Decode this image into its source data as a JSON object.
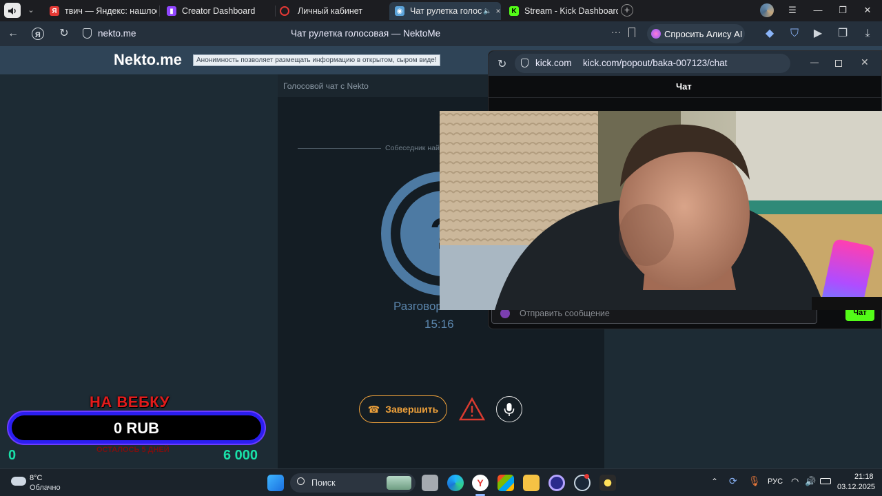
{
  "browser": {
    "tabs": [
      {
        "label": "твич — Яндекс: нашлось",
        "favicon": "yandex-icon",
        "color": "#e53935"
      },
      {
        "label": "Creator Dashboard",
        "favicon": "twitch-icon",
        "color": "#9146ff"
      },
      {
        "label": "Личный кабинет",
        "favicon": "opera-icon",
        "color": "#e53935"
      },
      {
        "label": "Чат рулетка голосо",
        "favicon": "nekto-icon",
        "color": "#5ba3d9",
        "active": true
      },
      {
        "label": "Stream - Kick Dashboard",
        "favicon": "kick-icon",
        "color": "#53fc18"
      }
    ],
    "address": "nekto.me",
    "page_title": "Чат рулетка голосовая — NektoMe",
    "alice_button": "Спросить Алису AI"
  },
  "nekto": {
    "logo": "Nekto.me",
    "tagline": "Анонимность позволяет размещать информацию в открытом, сыром виде!",
    "panel_title": "Голосовой чат с Nekto",
    "divider_text": "Собеседник най",
    "status_text": "Разговор",
    "timer": "15:16",
    "end_button": "Завершить"
  },
  "kick": {
    "url_domain": "kick.com",
    "url_path": "kick.com/popout/baka-007123/chat",
    "chat_header": "Чат",
    "message_placeholder": "Отправить сообщение",
    "send_button": "Чат"
  },
  "overlay": {
    "title": "НА ВЕБКУ",
    "amount": "0 RUB",
    "subtitle": "ОСТАЛОСЬ 5 ДНЕЙ",
    "min": "0",
    "max": "6 000",
    "progress": 0
  },
  "taskbar": {
    "weather_temp": "8°C",
    "weather_desc": "Облачно",
    "search_placeholder": "Поиск",
    "language": "РУС",
    "time": "21:18",
    "date": "03.12.2025"
  }
}
